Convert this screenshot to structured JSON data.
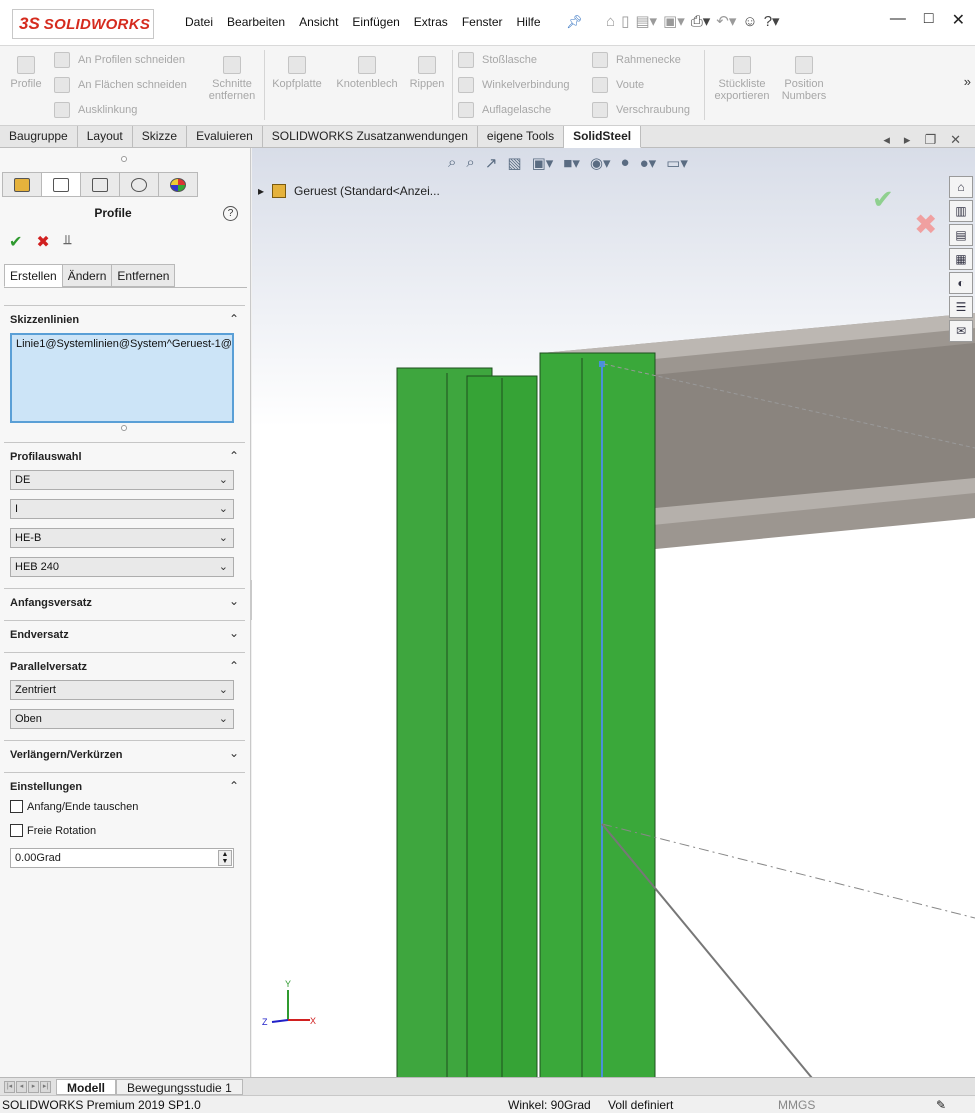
{
  "app": {
    "brand": "SOLIDWORKS",
    "menu": [
      "Datei",
      "Bearbeiten",
      "Ansicht",
      "Einfügen",
      "Extras",
      "Fenster",
      "Hilfe"
    ],
    "title_icons": [
      "home-icon",
      "new-icon",
      "open-icon",
      "print-icon",
      "undo-icon",
      "user-icon",
      "help-icon"
    ]
  },
  "command_manager": {
    "profile": "Profile",
    "cut_profiles": "An Profilen schneiden",
    "cut_faces": "An Flächen schneiden",
    "notch": "Ausklinkung",
    "remove_cuts": [
      "Schnitte",
      "entfernen"
    ],
    "end_plate": "Kopfplatte",
    "gusset": "Knotenblech",
    "ribs": "Rippen",
    "butt_strap": "Stoßlasche",
    "angle_joint": "Winkelverbindung",
    "support_strap": "Auflagelasche",
    "frame_corner": "Rahmenecke",
    "haunch": "Voute",
    "bolting": "Verschraubung",
    "export_bom": [
      "Stückliste",
      "exportieren"
    ],
    "position_numbers": [
      "Position",
      "Numbers"
    ]
  },
  "tabs": [
    "Baugruppe",
    "Layout",
    "Skizze",
    "Evaluieren",
    "SOLIDWORKS Zusatzanwendungen",
    "eigene Tools",
    "SolidSteel"
  ],
  "active_tab": "SolidSteel",
  "panel": {
    "title": "Profile",
    "subtabs": [
      "Erstellen",
      "Ändern",
      "Entfernen"
    ],
    "sections": {
      "sketch_lines": {
        "label": "Skizzenlinien",
        "items": [
          "Linie1@Systemlinien@System^Geruest-1@"
        ]
      },
      "profile_selection": {
        "label": "Profilauswahl",
        "standard": "DE",
        "type": "I",
        "series": "HE-B",
        "size": "HEB 240"
      },
      "start_offset": {
        "label": "Anfangsversatz"
      },
      "end_offset": {
        "label": "Endversatz"
      },
      "parallel_offset": {
        "label": "Parallelversatz",
        "horizontal": "Zentriert",
        "vertical": "Oben"
      },
      "extend_trim": {
        "label": "Verlängern/Verkürzen"
      },
      "settings": {
        "label": "Einstellungen",
        "swap_label": "Anfang/Ende tauschen",
        "swap_checked": false,
        "free_rotation_label": "Freie Rotation",
        "free_rotation_checked": false,
        "angle": "0.00Grad"
      }
    }
  },
  "viewport": {
    "tree_node": "Geruest  (Standard<Anzei...",
    "triad": {
      "x": "X",
      "y": "Y",
      "z": "Z"
    },
    "colors": {
      "beam_green": "#3aa83a",
      "beam_gray": "#9c9690",
      "sketch_blue": "#4a90d9"
    }
  },
  "bottom_tabs": [
    "Modell",
    "Bewegungsstudie 1"
  ],
  "active_bottom_tab": "Modell",
  "status": {
    "product": "SOLIDWORKS Premium 2019 SP1.0",
    "angle": "Winkel: 90Grad",
    "state": "Voll definiert",
    "units": "MMGS"
  }
}
